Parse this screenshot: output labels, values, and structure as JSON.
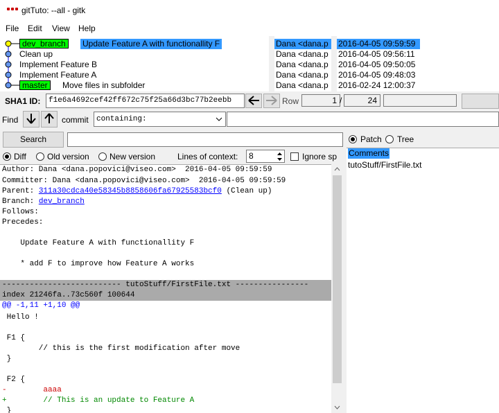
{
  "window": {
    "title": "gitTuto: --all - gitk"
  },
  "menu": {
    "file": "File",
    "edit": "Edit",
    "view": "View",
    "help": "Help"
  },
  "commits": [
    {
      "tag": "dev_branch",
      "message": "Update Feature A with functionallity F",
      "author": "Dana <dana.p",
      "date": "2016-04-05 09:59:59",
      "selected": true
    },
    {
      "tag": "",
      "message": "Clean up",
      "author": "Dana <dana.p",
      "date": "2016-04-05 09:56:11",
      "selected": false
    },
    {
      "tag": "",
      "message": "Implement Feature B",
      "author": "Dana <dana.p",
      "date": "2016-04-05 09:50:05",
      "selected": false
    },
    {
      "tag": "",
      "message": "Implement Feature A",
      "author": "Dana <dana.p",
      "date": "2016-04-05 09:48:03",
      "selected": false
    },
    {
      "tag": "master",
      "message": "Move files in subfolder",
      "author": "Dana <dana.p",
      "date": "2016-02-24 12:00:37",
      "selected": false
    }
  ],
  "sha": {
    "label": "SHA1 ID:",
    "value": "f1e6a4692cef42ff672c75f25a66d3bc77b2eebb",
    "row_label": "Row",
    "row_current": "1",
    "row_sep": "/",
    "row_total": "24"
  },
  "find": {
    "label": "Find",
    "mode": "commit",
    "containing": "containing:"
  },
  "search": {
    "button": "Search"
  },
  "diffopts": {
    "diff": "Diff",
    "old": "Old version",
    "new": "New version",
    "context_label": "Lines of context:",
    "context_value": "8",
    "ignore": "Ignore sp"
  },
  "right": {
    "patch": "Patch",
    "tree": "Tree",
    "comments": "Comments",
    "file": "tutoStuff/FirstFile.txt"
  },
  "diff": {
    "author": "Author: Dana <dana.popovici@viseo.com>  2016-04-05 09:59:59",
    "committer": "Committer: Dana <dana.popovici@viseo.com>  2016-04-05 09:59:59",
    "parent_prefix": "Parent: ",
    "parent_sha": "311a30cdca40e58345b8858606fa67925583bcf0",
    "parent_suffix": " (Clean up)",
    "branch_prefix": "Branch: ",
    "branch_name": "dev_branch",
    "follows": "Follows:",
    "precedes": "Precedes:",
    "subject": "    Update Feature A with functionallity F",
    "body": "    * add F to improve how Feature A works",
    "file_header": "-------------------------- tutoStuff/FirstFile.txt ----------------",
    "index": "index 21246fa..73c560f 100644",
    "hunk": "@@ -1,11 +1,10 @@",
    "lines": [
      {
        "text": " Hello !",
        "kind": "ctx"
      },
      {
        "text": " ",
        "kind": "ctx"
      },
      {
        "text": " F1 {",
        "kind": "ctx"
      },
      {
        "text": "        // this is the first modification after move",
        "kind": "ctx"
      },
      {
        "text": " }",
        "kind": "ctx"
      },
      {
        "text": " ",
        "kind": "ctx"
      },
      {
        "text": " F2 {",
        "kind": "ctx"
      },
      {
        "text": "-        aaaa",
        "kind": "del"
      },
      {
        "text": "+        // This is an update to Feature A",
        "kind": "add"
      },
      {
        "text": " }",
        "kind": "ctx"
      }
    ]
  }
}
